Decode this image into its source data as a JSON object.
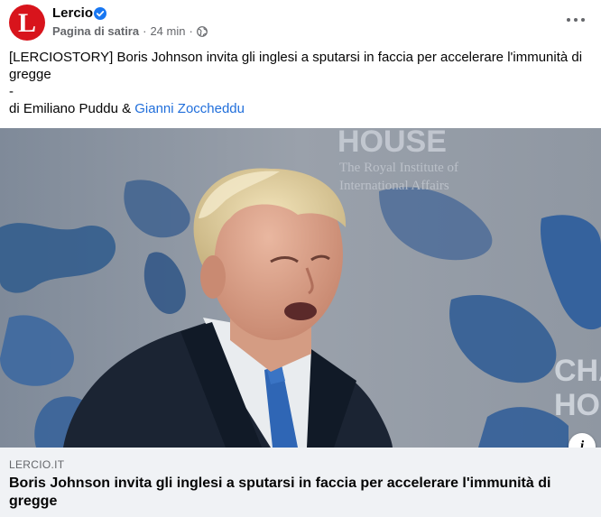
{
  "header": {
    "page_name": "Lercio",
    "avatar_letter": "L",
    "category": "Pagina di satira",
    "time": "24 min"
  },
  "post": {
    "title_line": "[LERCIOSTORY] Boris Johnson invita gli inglesi a sputarsi in faccia per accelerare l'immunità di gregge",
    "separator": "-",
    "byline_prefix": "di Emiliano Puddu & ",
    "author_link": "Gianni Zoccheddu"
  },
  "photo": {
    "background_text_1": "HOUSE",
    "background_text_2": "The Royal Institute of",
    "background_text_3": "International Affairs",
    "side_text_1": "CHA",
    "side_text_2": "HO"
  },
  "link_card": {
    "domain": "LERCIO.IT",
    "title": "Boris Johnson invita gli inglesi a sputarsi in faccia per accelerare l'immunità di gregge"
  },
  "icons": {
    "verified": "verified-badge-icon",
    "globe": "globe-icon",
    "more": "more-options-icon",
    "info": "info-icon"
  },
  "colors": {
    "brand_red": "#d8141c",
    "link_blue": "#216fdb",
    "verified_blue": "#1877f2",
    "muted_text": "#65676b",
    "card_bg": "#f0f2f5"
  }
}
